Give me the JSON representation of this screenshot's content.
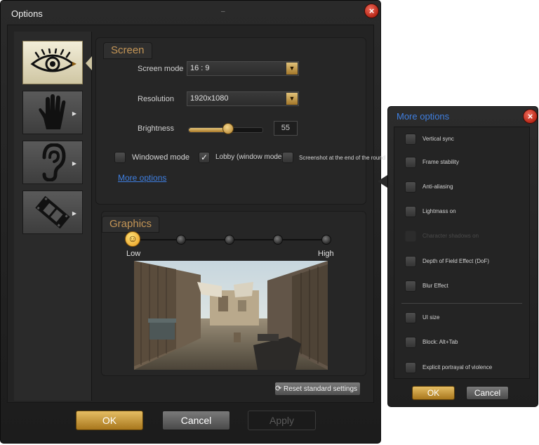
{
  "window": {
    "title": "Options",
    "dash": "–",
    "close_symbol": "×"
  },
  "sidebar": {
    "items": [
      {
        "name": "eye",
        "active": true
      },
      {
        "name": "hand",
        "active": false
      },
      {
        "name": "ear",
        "active": false
      },
      {
        "name": "film",
        "active": false
      }
    ]
  },
  "screen": {
    "title": "Screen",
    "screen_mode_label": "Screen mode",
    "screen_mode_value": "16 : 9",
    "resolution_label": "Resolution",
    "resolution_value": "1920x1080",
    "brightness_label": "Brightness",
    "brightness_value": "55",
    "brightness_level": 0.55,
    "windowed_mode_label": "Windowed mode",
    "windowed_mode_checked": false,
    "lobby_label": "Lobby (window mode)",
    "lobby_checked": true,
    "screenshot_label": "Screenshot at the end of the round",
    "screenshot_checked": false,
    "more_options_link": "More options"
  },
  "graphics": {
    "title": "Graphics",
    "low_label": "Low",
    "high_label": "High",
    "selected_level": 1,
    "level_count": 5
  },
  "buttons": {
    "reset_label": "Reset standard settings",
    "ok_label": "OK",
    "cancel_label": "Cancel",
    "apply_label": "Apply"
  },
  "more_options": {
    "title": "More options",
    "items": [
      {
        "label": "Vertical sync",
        "checked": false,
        "disabled": false
      },
      {
        "label": "Frame stability",
        "checked": false,
        "disabled": false
      },
      {
        "label": "Anti-aliasing",
        "checked": false,
        "disabled": false
      },
      {
        "label": "Lightmass on",
        "checked": false,
        "disabled": false
      },
      {
        "label": "Character shadows on",
        "checked": false,
        "disabled": true
      },
      {
        "label": "Depth of Field Effect (DoF)",
        "checked": false,
        "disabled": false
      },
      {
        "label": "Blur Effect",
        "checked": false,
        "disabled": false
      },
      {
        "label": "UI size",
        "checked": false,
        "disabled": false
      },
      {
        "label": "Block: Alt+Tab",
        "checked": false,
        "disabled": false
      },
      {
        "label": "Explicit portrayal of violence",
        "checked": false,
        "disabled": false
      }
    ],
    "ok_label": "OK",
    "cancel_label": "Cancel"
  },
  "colors": {
    "accent_gold": "#c49556",
    "link_blue": "#3f7fe0",
    "close_red": "#c0301c"
  }
}
